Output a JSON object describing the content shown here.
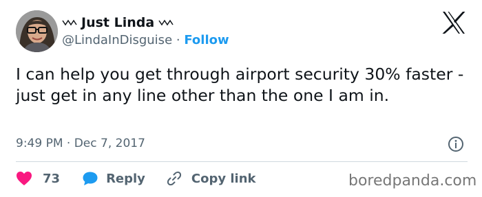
{
  "header": {
    "name_prefix_icon": "squiggle-icon",
    "display_name": "Just Linda",
    "name_suffix_icon": "squiggle-icon",
    "handle": "@LindaInDisguise",
    "separator": "·",
    "follow_label": "Follow",
    "logo_icon": "x-logo-icon"
  },
  "tweet": {
    "text": "I can help you get through airport security 30% faster - just get in any line other than the one I am in.",
    "time": "9:49 PM",
    "separator": "·",
    "date": "Dec 7, 2017",
    "info_icon": "info-icon"
  },
  "actions": {
    "like_icon": "heart-icon",
    "like_count": "73",
    "reply_icon": "reply-bubble-icon",
    "reply_label": "Reply",
    "copy_icon": "link-icon",
    "copy_label": "Copy link"
  },
  "watermark": "boredpanda.com",
  "colors": {
    "accent": "#1d9bf0",
    "like": "#f91880",
    "secondary_text": "#536471",
    "divider": "#cfd9de"
  }
}
